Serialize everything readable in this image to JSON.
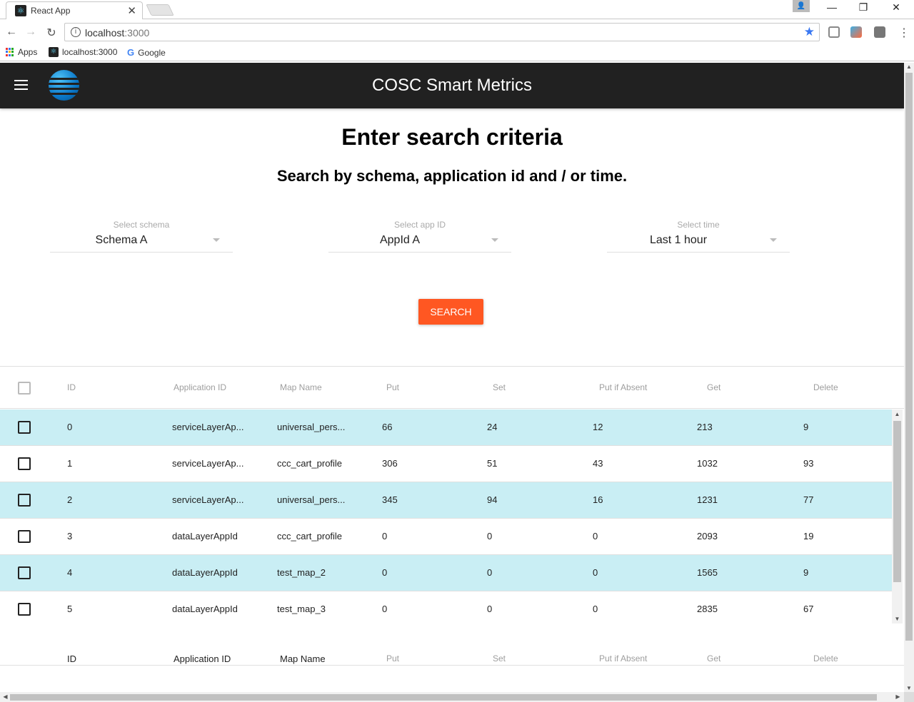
{
  "browser": {
    "tab_title": "React App",
    "url_host": "localhost",
    "url_port": ":3000",
    "bookmarks": {
      "apps": "Apps",
      "localhost": "localhost:3000",
      "google": "Google"
    }
  },
  "app": {
    "title": "COSC Smart Metrics",
    "heading": "Enter search criteria",
    "subheading": "Search by schema, application id and / or time.",
    "filters": [
      {
        "label": "Select schema",
        "value": "Schema A"
      },
      {
        "label": "Select app ID",
        "value": "AppId A"
      },
      {
        "label": "Select time",
        "value": "Last 1 hour"
      }
    ],
    "search_label": "SEARCH",
    "accent": "#ff5722",
    "row_highlight": "#c9eef4"
  },
  "table": {
    "columns": [
      "ID",
      "Application ID",
      "Map Name",
      "Put",
      "Set",
      "Put if Absent",
      "Get",
      "Delete"
    ],
    "rows": [
      [
        "0",
        "serviceLayerAp...",
        "universal_pers...",
        "66",
        "24",
        "12",
        "213",
        "9"
      ],
      [
        "1",
        "serviceLayerAp...",
        "ccc_cart_profile",
        "306",
        "51",
        "43",
        "1032",
        "93"
      ],
      [
        "2",
        "serviceLayerAp...",
        "universal_pers...",
        "345",
        "94",
        "16",
        "1231",
        "77"
      ],
      [
        "3",
        "dataLayerAppId",
        "ccc_cart_profile",
        "0",
        "0",
        "0",
        "2093",
        "19"
      ],
      [
        "4",
        "dataLayerAppId",
        "test_map_2",
        "0",
        "0",
        "0",
        "1565",
        "9"
      ],
      [
        "5",
        "dataLayerAppId",
        "test_map_3",
        "0",
        "0",
        "0",
        "2835",
        "67"
      ]
    ]
  }
}
